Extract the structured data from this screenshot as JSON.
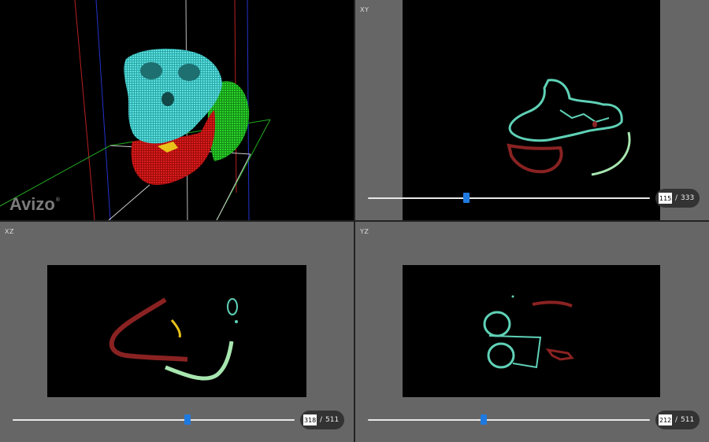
{
  "app": {
    "logo_text": "Avizo",
    "logo_mark": "®"
  },
  "colors": {
    "cranium": "#3fc3c3",
    "mandible": "#c81414",
    "hyoid": "#e8c21a",
    "shell": "#22c322",
    "bone_slice": "#5fd1b6",
    "slice_red": "#8a2222",
    "slice_light": "#a8e6b0",
    "slider_thumb": "#1f7ae0"
  },
  "views": {
    "xy": {
      "label": "XY",
      "slice": "115",
      "total": "333",
      "position": 0.35
    },
    "xz": {
      "label": "XZ",
      "slice": "318",
      "total": "511",
      "position": 0.62
    },
    "yz": {
      "label": "YZ",
      "slice": "212",
      "total": "511",
      "position": 0.41
    }
  },
  "common": {
    "separator": "/"
  }
}
